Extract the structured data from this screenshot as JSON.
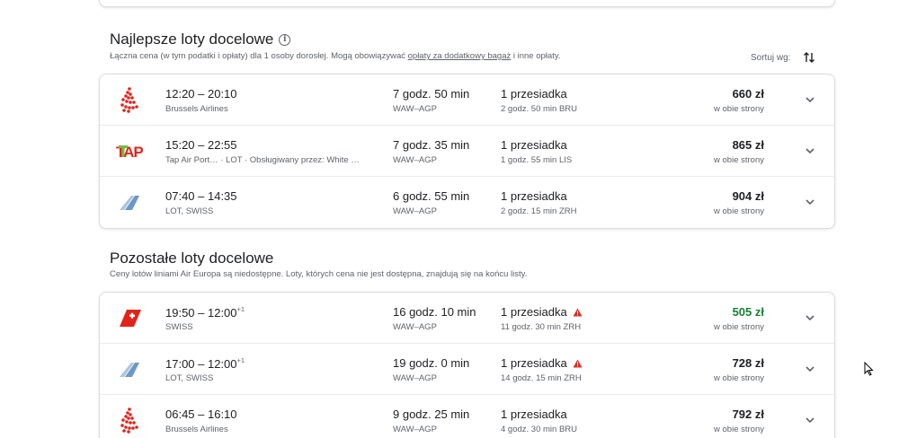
{
  "best": {
    "title": "Najlepsze loty docelowe",
    "subtitle_pre": "Łączna cena (w tym podatki i opłaty) dla 1 osoby dorosłej. Mogą obowiązywać ",
    "subtitle_link": "opłaty za dodatkowy bagaż",
    "subtitle_post": " i inne opłaty.",
    "sort_label": "Sortuj wg:",
    "flights": [
      {
        "logo": "brussels-airlines-logo",
        "times": "12:20 – 20:10",
        "plus": "",
        "airline": "Brussels Airlines",
        "duration": "7 godz. 50 min",
        "route": "WAW–AGP",
        "stops": "1 przesiadka",
        "warning": false,
        "stop_detail": "2 godz. 50 min BRU",
        "price": "660 zł",
        "price_note": "w obie strony",
        "price_color": "#202124"
      },
      {
        "logo": "tap-logo",
        "times": "15:20 – 22:55",
        "plus": "",
        "airline": "Tap Air Port…   ·   LOT   ·   Obsługiwany przez: White …",
        "duration": "7 godz. 35 min",
        "route": "WAW–AGP",
        "stops": "1 przesiadka",
        "warning": false,
        "stop_detail": "1 godz. 55 min LIS",
        "price": "865 zł",
        "price_note": "w obie strony",
        "price_color": "#202124"
      },
      {
        "logo": "lot-logo",
        "times": "07:40 – 14:35",
        "plus": "",
        "airline": "LOT, SWISS",
        "duration": "6 godz. 55 min",
        "route": "WAW–AGP",
        "stops": "1 przesiadka",
        "warning": false,
        "stop_detail": "2 godz. 15 min ZRH",
        "price": "904 zł",
        "price_note": "w obie strony",
        "price_color": "#202124"
      }
    ]
  },
  "other": {
    "title": "Pozostałe loty docelowe",
    "subtitle": "Ceny lotów liniami Air Europa są niedostępne. Loty, których cena nie jest dostępna, znajdują się na końcu listy.",
    "flights": [
      {
        "logo": "swiss-logo",
        "times": "19:50 – 12:00",
        "plus": "+1",
        "airline": "SWISS",
        "duration": "16 godz. 10 min",
        "route": "WAW–AGP",
        "stops": "1 przesiadka",
        "warning": true,
        "stop_detail": "11 godz. 30 min ZRH",
        "price": "505 zł",
        "price_note": "w obie strony",
        "price_color": "#188038"
      },
      {
        "logo": "lot-logo",
        "times": "17:00 – 12:00",
        "plus": "+1",
        "airline": "LOT, SWISS",
        "duration": "19 godz. 0 min",
        "route": "WAW–AGP",
        "stops": "1 przesiadka",
        "warning": true,
        "stop_detail": "14 godz. 15 min ZRH",
        "price": "728 zł",
        "price_note": "w obie strony",
        "price_color": "#202124"
      },
      {
        "logo": "brussels-airlines-logo",
        "times": "06:45 – 16:10",
        "plus": "",
        "airline": "Brussels Airlines",
        "duration": "9 godz. 25 min",
        "route": "WAW–AGP",
        "stops": "1 przesiadka",
        "warning": false,
        "stop_detail": "4 godz. 30 min BRU",
        "price": "792 zł",
        "price_note": "w obie strony",
        "price_color": "#202124"
      }
    ]
  }
}
